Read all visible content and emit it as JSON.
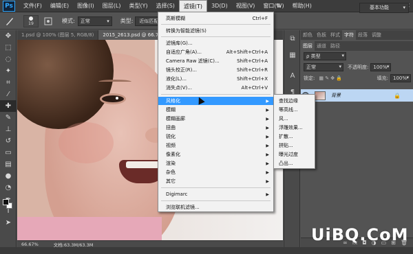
{
  "app": {
    "logo": "Ps"
  },
  "menubar": {
    "items": [
      "文件(F)",
      "编辑(E)",
      "图像(I)",
      "图层(L)",
      "类型(Y)",
      "选择(S)",
      "滤镜(T)",
      "3D(D)",
      "视图(V)",
      "窗口(W)",
      "帮助(H)"
    ],
    "active": "滤镜(T)",
    "window_controls": [
      "—",
      "□",
      "✕"
    ]
  },
  "options": {
    "brush_size": "19",
    "mode_label": "模式:",
    "mode_value": "正常",
    "type_label": "类型:",
    "type_value": "近似匹配",
    "workspace": "基本功能"
  },
  "doc_tabs": [
    {
      "label": "1.psd @ 100% (图层 5, RGB/8)",
      "active": false
    },
    {
      "label": "2015_2613.psd @ 66.7%",
      "active": true
    }
  ],
  "status": {
    "zoom": "66.67%",
    "doc_info": "文档:63.3M/63.3M"
  },
  "panels": {
    "top_tabs": [
      "颜色",
      "色板",
      "样式",
      "字符",
      "段落",
      "调整"
    ],
    "active_top": "字符",
    "layer_tabs": [
      "图层",
      "通道",
      "路径"
    ],
    "active_layer_tab": "图层",
    "filter_kind": "ρ 类型",
    "blend_mode": "正常",
    "opacity_label": "不透明度:",
    "opacity_value": "100%",
    "lock_label": "锁定:",
    "fill_label": "填充:",
    "fill_value": "100%",
    "layer_name": "背景"
  },
  "filter_menu": {
    "items": [
      {
        "label": "高斯模糊",
        "shortcut": "Ctrl+F"
      },
      {
        "label": "转换为智能滤镜(S)"
      },
      {
        "label": "滤镜库(G)..."
      },
      {
        "label": "自适应广角(A)...",
        "shortcut": "Alt+Shift+Ctrl+A"
      },
      {
        "label": "Camera Raw 滤镜(C)...",
        "shortcut": "Shift+Ctrl+A"
      },
      {
        "label": "镜头校正(R)...",
        "shortcut": "Shift+Ctrl+R"
      },
      {
        "label": "液化(L)...",
        "shortcut": "Shift+Ctrl+X"
      },
      {
        "label": "消失点(V)...",
        "shortcut": "Alt+Ctrl+V"
      },
      {
        "label": "风格化",
        "submenu": true,
        "highlighted": true
      },
      {
        "label": "模糊",
        "submenu": true
      },
      {
        "label": "模糊画廊",
        "submenu": true
      },
      {
        "label": "扭曲",
        "submenu": true
      },
      {
        "label": "锐化",
        "submenu": true
      },
      {
        "label": "视频",
        "submenu": true
      },
      {
        "label": "像素化",
        "submenu": true
      },
      {
        "label": "渲染",
        "submenu": true
      },
      {
        "label": "杂色",
        "submenu": true
      },
      {
        "label": "其它",
        "submenu": true
      },
      {
        "label": "Digimarc",
        "submenu": true
      },
      {
        "label": "浏览联机滤镜..."
      }
    ]
  },
  "stylize_submenu": {
    "items": [
      "查找边缘",
      "等高线...",
      "风...",
      "浮雕效果...",
      "扩散...",
      "拼贴...",
      "曝光过度",
      "凸出..."
    ]
  },
  "watermark": {
    "text": "UiBQ.CoM"
  },
  "colors": {
    "menu_highlight": "#3399ff",
    "layer_selected": "#bcd6f3",
    "brand": "#31a8ff"
  }
}
